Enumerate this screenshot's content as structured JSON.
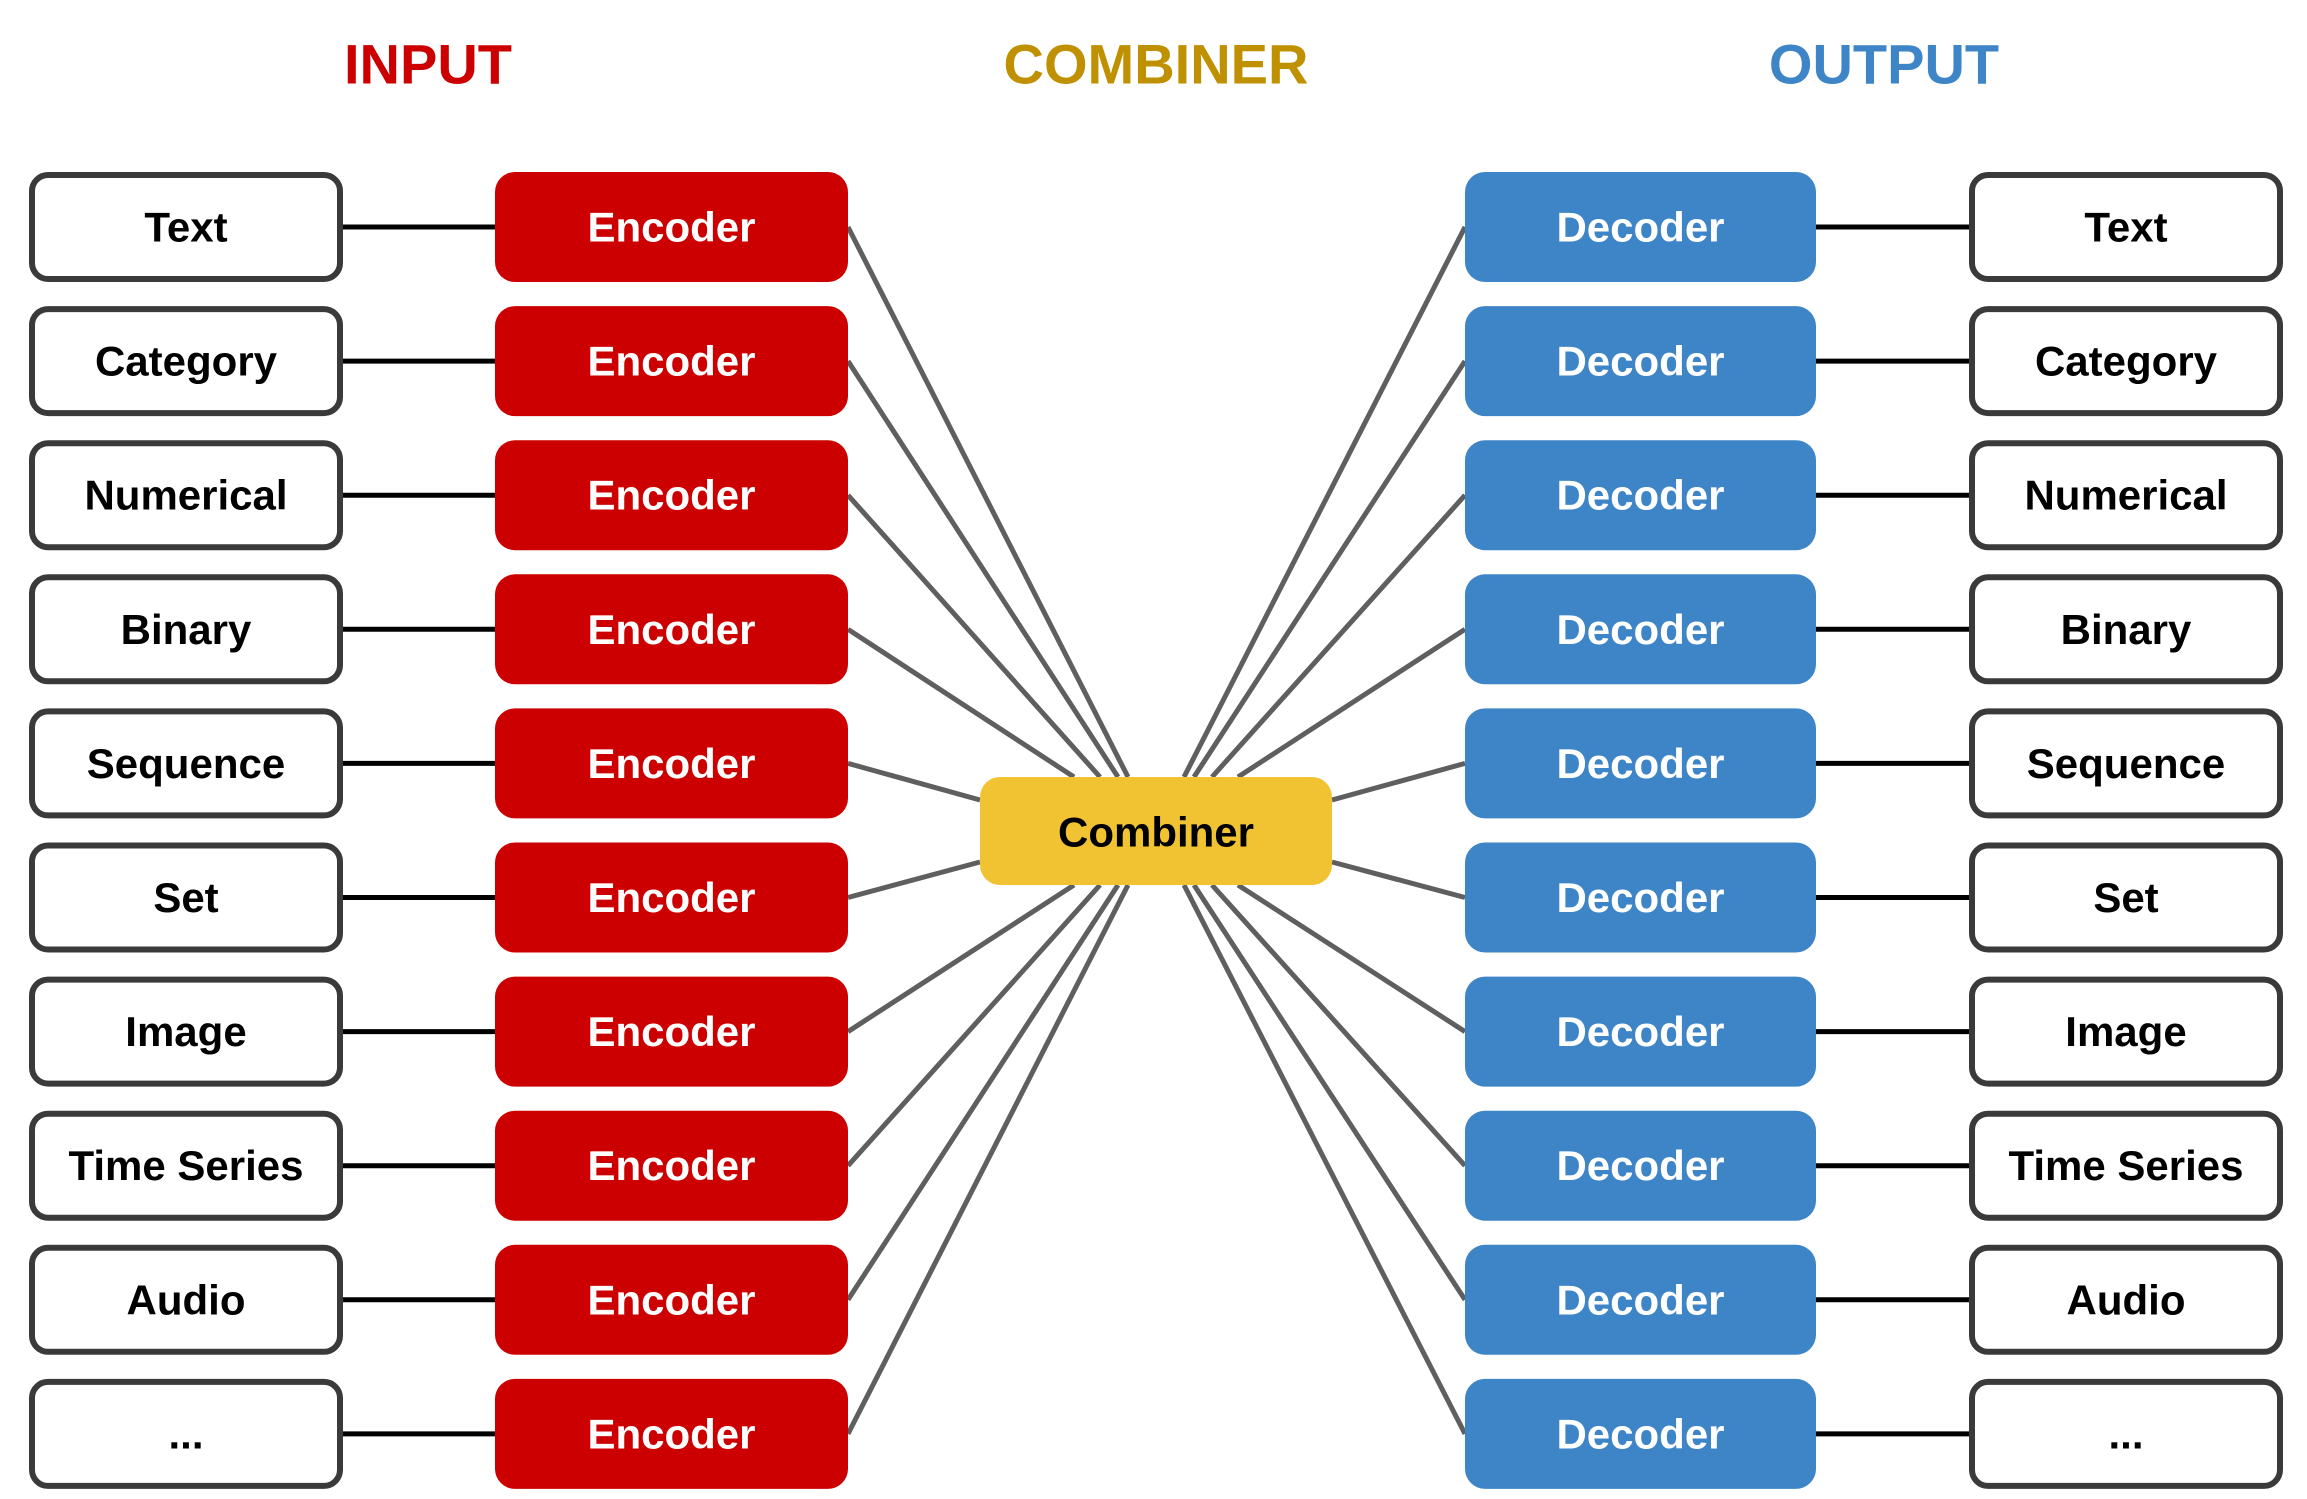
{
  "colors": {
    "input": "#cc0000",
    "combiner_title": "#bf9000",
    "combiner_fill": "#f1c232",
    "output": "#3d85c6",
    "connector": "#5f5f5f",
    "feature_border": "#3a3a3a",
    "text_dark": "#000000",
    "text_light": "#ffffff"
  },
  "titles": {
    "input": "INPUT",
    "combiner": "COMBINER",
    "output": "OUTPUT"
  },
  "combiner_label": "Combiner",
  "encoder_label": "Encoder",
  "decoder_label": "Decoder",
  "input_features": [
    "Text",
    "Category",
    "Numerical",
    "Binary",
    "Sequence",
    "Set",
    "Image",
    "Time Series",
    "Audio",
    "..."
  ],
  "output_features": [
    "Text",
    "Category",
    "Numerical",
    "Binary",
    "Sequence",
    "Set",
    "Image",
    "Time Series",
    "Audio",
    "..."
  ]
}
